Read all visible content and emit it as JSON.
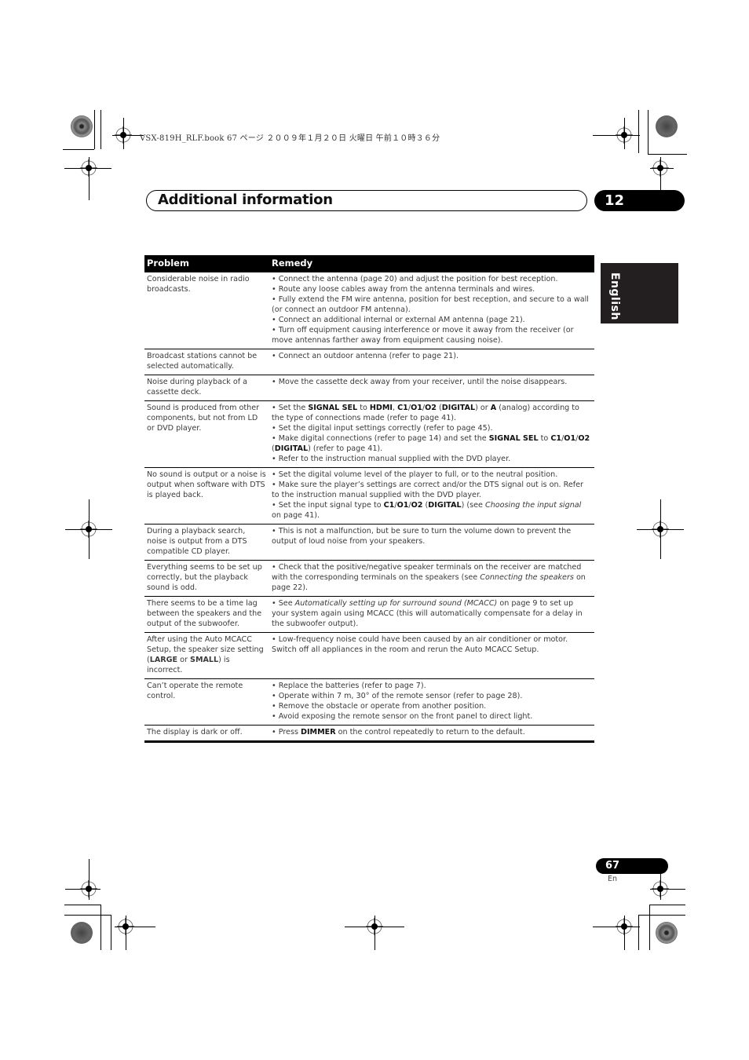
{
  "print_header": "VSX-819H_RLF.book  67 ページ  ２００９年１月２０日  火曜日  午前１０時３６分",
  "chapter": {
    "title": "Additional information",
    "number": "12"
  },
  "language_tab": "English",
  "table": {
    "headers": {
      "problem": "Problem",
      "remedy": "Remedy"
    },
    "rows": [
      {
        "problem": "Considerable noise in radio broadcasts.",
        "remedy": [
          "• Connect the antenna (page 20) and adjust the position for best reception.",
          "• Route any loose cables away from the antenna terminals and wires.",
          "• Fully extend the FM wire antenna, position for best reception, and secure to a wall (or connect an outdoor FM antenna).",
          "• Connect an additional internal or external AM antenna (page 21).",
          "• Turn off equipment causing interference or move it away from the receiver (or move antennas farther away from equipment causing noise)."
        ]
      },
      {
        "problem": "Broadcast stations cannot be selected automatically.",
        "remedy": [
          "• Connect an outdoor antenna (refer to page 21)."
        ]
      },
      {
        "problem": "Noise during playback of a cassette deck.",
        "remedy": [
          "• Move the cassette deck away from your receiver, until the noise disappears."
        ]
      },
      {
        "problem": "Sound is produced from other components, but not from LD or DVD player.",
        "remedy_html": [
          "• Set the <b>SIGNAL SEL</b> to <b>HDMI</b>, <b>C1</b>/<b>O1</b>/<b>O2</b> (<b>DIGITAL</b>) or <b>A</b> (analog) according to the type of connections made (refer to page 41).",
          "• Set the digital input settings correctly (refer to page 45).",
          "• Make digital connections (refer to page 14) and set the <b>SIGNAL SEL</b> to <b>C1</b>/<b>O1</b>/<b>O2</b> (<b>DIGITAL</b>) (refer to page 41).",
          "• Refer to the instruction manual supplied with the DVD player."
        ]
      },
      {
        "problem": "No sound is output or a noise is output when software with DTS is played back.",
        "remedy_html": [
          "• Set the digital volume level of the player to full, or to the neutral position.",
          "• Make sure the player’s settings are correct and/or the DTS signal out is on. Refer to the instruction manual supplied with the DVD player.",
          "• Set the input signal type to <b>C1</b>/<b>O1</b>/<b>O2</b> (<b>DIGITAL</b>) (see <i>Choosing the input signal</i> on page 41)."
        ]
      },
      {
        "problem": "During a playback search, noise is output from a DTS compatible CD player.",
        "remedy": [
          "• This is not a malfunction, but be sure to turn the volume down to prevent the output of loud noise from your speakers."
        ]
      },
      {
        "problem": "Everything seems to be set up correctly, but the playback sound is odd.",
        "remedy_html": [
          "• Check that the positive/negative speaker terminals on the receiver are matched with the corresponding terminals on the speakers (see <i>Connecting the speakers</i> on page 22)."
        ]
      },
      {
        "problem": "There seems to be a time lag between the speakers and the output of the subwoofer.",
        "remedy_html": [
          "• See <i>Automatically setting up for surround sound (MCACC)</i> on page 9 to set up your system again using MCACC (this will automatically compensate for a delay in the subwoofer output)."
        ]
      },
      {
        "problem_html": "After using the Auto MCACC Setup, the speaker size setting (<b>LARGE</b> or <b>SMALL</b>) is incorrect.",
        "remedy": [
          "• Low-frequency noise could have been caused by an air conditioner or motor. Switch off all appliances in the room and rerun the Auto MCACC Setup."
        ]
      },
      {
        "problem": "Can’t operate the remote control.",
        "remedy": [
          "• Replace the batteries (refer to page 7).",
          "• Operate within 7 m, 30° of the remote sensor (refer to page 28).",
          "• Remove the obstacle or operate from another position.",
          "• Avoid exposing the remote sensor on the front panel to direct light."
        ]
      },
      {
        "problem": "The display is dark or off.",
        "remedy_html": [
          "• Press <b>DIMMER</b> on the control repeatedly to return to the default."
        ]
      }
    ]
  },
  "footer": {
    "page_number": "67",
    "language_code": "En"
  }
}
